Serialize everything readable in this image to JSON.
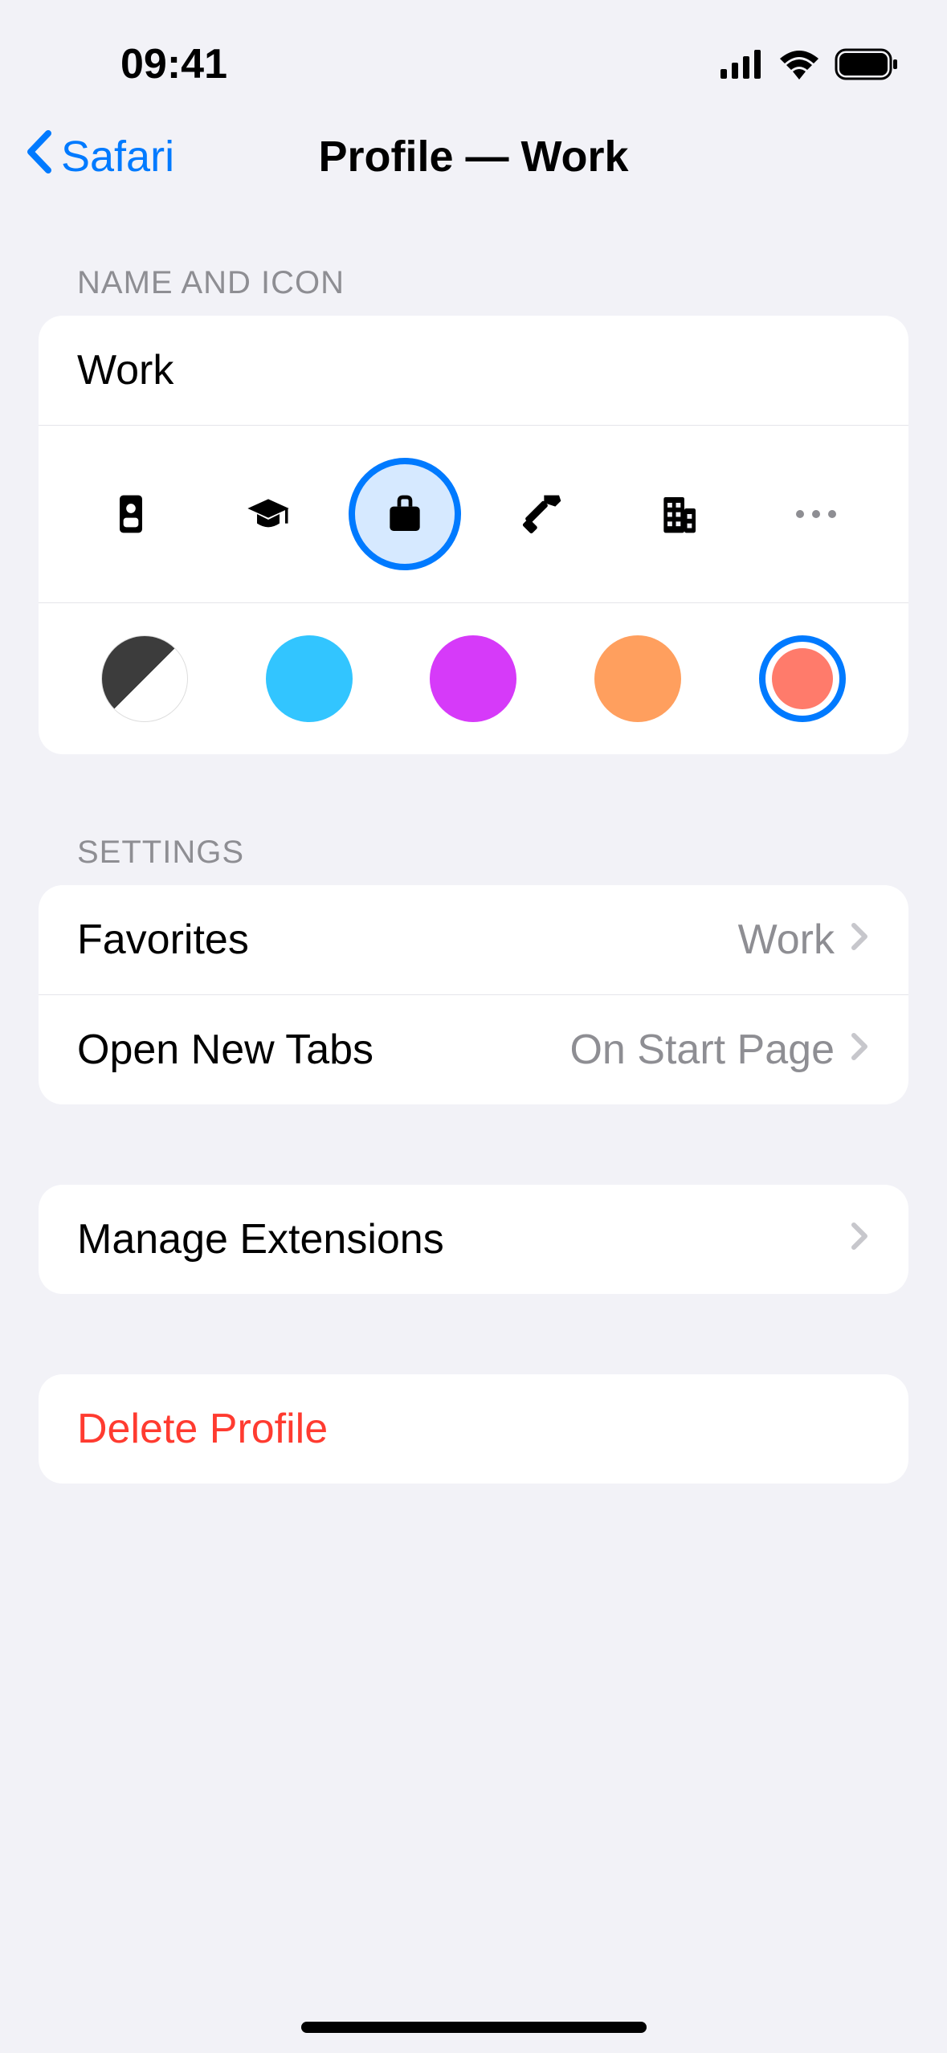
{
  "statusBar": {
    "time": "09:41"
  },
  "nav": {
    "backLabel": "Safari",
    "title": "Profile — Work"
  },
  "sections": {
    "nameIcon": {
      "header": "NAME AND ICON",
      "profileName": "Work",
      "icons": [
        {
          "name": "badge-icon",
          "selected": false
        },
        {
          "name": "graduation-cap-icon",
          "selected": false
        },
        {
          "name": "briefcase-icon",
          "selected": true
        },
        {
          "name": "hammer-icon",
          "selected": false
        },
        {
          "name": "building-icon",
          "selected": false
        },
        {
          "name": "more-icon",
          "selected": false
        }
      ],
      "colors": [
        {
          "name": "black-white",
          "hex": "bw",
          "selected": false
        },
        {
          "name": "cyan",
          "hex": "#32c5ff",
          "selected": false
        },
        {
          "name": "magenta",
          "hex": "#d63af9",
          "selected": false
        },
        {
          "name": "orange",
          "hex": "#ff9f5e",
          "selected": false
        },
        {
          "name": "coral",
          "hex": "#ff7b6b",
          "selected": true
        }
      ]
    },
    "settings": {
      "header": "SETTINGS",
      "rows": [
        {
          "label": "Favorites",
          "value": "Work"
        },
        {
          "label": "Open New Tabs",
          "value": "On Start Page"
        }
      ]
    },
    "extensions": {
      "label": "Manage Extensions"
    },
    "delete": {
      "label": "Delete Profile"
    }
  }
}
